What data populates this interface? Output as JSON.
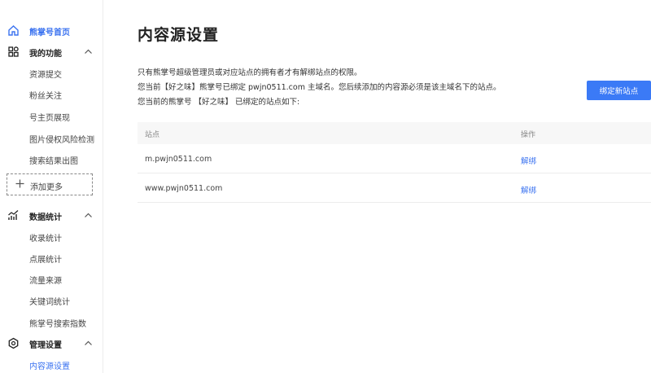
{
  "sidebar": {
    "home": {
      "label": "熊掌号首页",
      "icon": "home-icon"
    },
    "groups": [
      {
        "label": "我的功能",
        "icon": "apps-grid-icon",
        "items": [
          "资源提交",
          "粉丝关注",
          "号主页展现",
          "图片侵权风险检测",
          "搜索结果出图"
        ]
      },
      {
        "label": "数据统计",
        "icon": "chart-icon",
        "items": [
          "收录统计",
          "点展统计",
          "流量来源",
          "关键词统计",
          "熊掌号搜索指数"
        ]
      },
      {
        "label": "管理设置",
        "icon": "settings-hexagon-icon",
        "items": [
          "内容源设置"
        ]
      }
    ],
    "add_more": "添加更多",
    "active_item": "内容源设置"
  },
  "main": {
    "title": "内容源设置",
    "desc_lines": [
      "只有熊掌号超级管理员或对应站点的拥有者才有解绑站点的权限。",
      "您当前【好之味】熊掌号已绑定 pwjn0511.com 主域名。您后续添加的内容源必须是该主域名下的站点。",
      "您当前的熊掌号 【好之味】 已绑定的站点如下:"
    ],
    "bind_button": "绑定新站点",
    "table": {
      "headers": [
        "站点",
        "操作"
      ],
      "rows": [
        {
          "site": "m.pwjn0511.com",
          "action": "解绑"
        },
        {
          "site": "www.pwjn0511.com",
          "action": "解绑"
        }
      ]
    }
  },
  "colors": {
    "accent": "#3b73f0",
    "button": "#3b7af6"
  }
}
